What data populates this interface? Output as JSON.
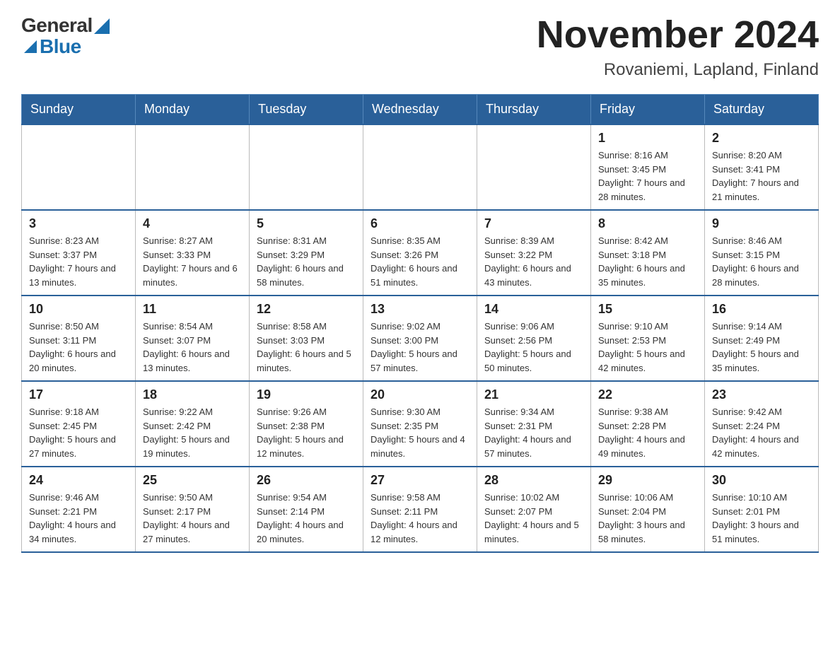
{
  "header": {
    "logo_general": "General",
    "logo_blue": "Blue",
    "month_title": "November 2024",
    "location": "Rovaniemi, Lapland, Finland"
  },
  "days_of_week": [
    "Sunday",
    "Monday",
    "Tuesday",
    "Wednesday",
    "Thursday",
    "Friday",
    "Saturday"
  ],
  "weeks": [
    {
      "days": [
        {
          "number": "",
          "info": ""
        },
        {
          "number": "",
          "info": ""
        },
        {
          "number": "",
          "info": ""
        },
        {
          "number": "",
          "info": ""
        },
        {
          "number": "",
          "info": ""
        },
        {
          "number": "1",
          "info": "Sunrise: 8:16 AM\nSunset: 3:45 PM\nDaylight: 7 hours and 28 minutes."
        },
        {
          "number": "2",
          "info": "Sunrise: 8:20 AM\nSunset: 3:41 PM\nDaylight: 7 hours and 21 minutes."
        }
      ]
    },
    {
      "days": [
        {
          "number": "3",
          "info": "Sunrise: 8:23 AM\nSunset: 3:37 PM\nDaylight: 7 hours and 13 minutes."
        },
        {
          "number": "4",
          "info": "Sunrise: 8:27 AM\nSunset: 3:33 PM\nDaylight: 7 hours and 6 minutes."
        },
        {
          "number": "5",
          "info": "Sunrise: 8:31 AM\nSunset: 3:29 PM\nDaylight: 6 hours and 58 minutes."
        },
        {
          "number": "6",
          "info": "Sunrise: 8:35 AM\nSunset: 3:26 PM\nDaylight: 6 hours and 51 minutes."
        },
        {
          "number": "7",
          "info": "Sunrise: 8:39 AM\nSunset: 3:22 PM\nDaylight: 6 hours and 43 minutes."
        },
        {
          "number": "8",
          "info": "Sunrise: 8:42 AM\nSunset: 3:18 PM\nDaylight: 6 hours and 35 minutes."
        },
        {
          "number": "9",
          "info": "Sunrise: 8:46 AM\nSunset: 3:15 PM\nDaylight: 6 hours and 28 minutes."
        }
      ]
    },
    {
      "days": [
        {
          "number": "10",
          "info": "Sunrise: 8:50 AM\nSunset: 3:11 PM\nDaylight: 6 hours and 20 minutes."
        },
        {
          "number": "11",
          "info": "Sunrise: 8:54 AM\nSunset: 3:07 PM\nDaylight: 6 hours and 13 minutes."
        },
        {
          "number": "12",
          "info": "Sunrise: 8:58 AM\nSunset: 3:03 PM\nDaylight: 6 hours and 5 minutes."
        },
        {
          "number": "13",
          "info": "Sunrise: 9:02 AM\nSunset: 3:00 PM\nDaylight: 5 hours and 57 minutes."
        },
        {
          "number": "14",
          "info": "Sunrise: 9:06 AM\nSunset: 2:56 PM\nDaylight: 5 hours and 50 minutes."
        },
        {
          "number": "15",
          "info": "Sunrise: 9:10 AM\nSunset: 2:53 PM\nDaylight: 5 hours and 42 minutes."
        },
        {
          "number": "16",
          "info": "Sunrise: 9:14 AM\nSunset: 2:49 PM\nDaylight: 5 hours and 35 minutes."
        }
      ]
    },
    {
      "days": [
        {
          "number": "17",
          "info": "Sunrise: 9:18 AM\nSunset: 2:45 PM\nDaylight: 5 hours and 27 minutes."
        },
        {
          "number": "18",
          "info": "Sunrise: 9:22 AM\nSunset: 2:42 PM\nDaylight: 5 hours and 19 minutes."
        },
        {
          "number": "19",
          "info": "Sunrise: 9:26 AM\nSunset: 2:38 PM\nDaylight: 5 hours and 12 minutes."
        },
        {
          "number": "20",
          "info": "Sunrise: 9:30 AM\nSunset: 2:35 PM\nDaylight: 5 hours and 4 minutes."
        },
        {
          "number": "21",
          "info": "Sunrise: 9:34 AM\nSunset: 2:31 PM\nDaylight: 4 hours and 57 minutes."
        },
        {
          "number": "22",
          "info": "Sunrise: 9:38 AM\nSunset: 2:28 PM\nDaylight: 4 hours and 49 minutes."
        },
        {
          "number": "23",
          "info": "Sunrise: 9:42 AM\nSunset: 2:24 PM\nDaylight: 4 hours and 42 minutes."
        }
      ]
    },
    {
      "days": [
        {
          "number": "24",
          "info": "Sunrise: 9:46 AM\nSunset: 2:21 PM\nDaylight: 4 hours and 34 minutes."
        },
        {
          "number": "25",
          "info": "Sunrise: 9:50 AM\nSunset: 2:17 PM\nDaylight: 4 hours and 27 minutes."
        },
        {
          "number": "26",
          "info": "Sunrise: 9:54 AM\nSunset: 2:14 PM\nDaylight: 4 hours and 20 minutes."
        },
        {
          "number": "27",
          "info": "Sunrise: 9:58 AM\nSunset: 2:11 PM\nDaylight: 4 hours and 12 minutes."
        },
        {
          "number": "28",
          "info": "Sunrise: 10:02 AM\nSunset: 2:07 PM\nDaylight: 4 hours and 5 minutes."
        },
        {
          "number": "29",
          "info": "Sunrise: 10:06 AM\nSunset: 2:04 PM\nDaylight: 3 hours and 58 minutes."
        },
        {
          "number": "30",
          "info": "Sunrise: 10:10 AM\nSunset: 2:01 PM\nDaylight: 3 hours and 51 minutes."
        }
      ]
    }
  ]
}
